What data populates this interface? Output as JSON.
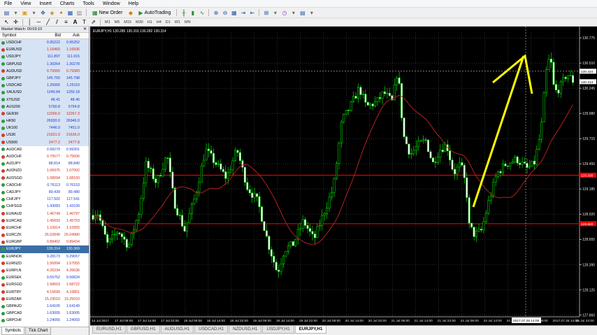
{
  "menu": [
    "File",
    "View",
    "Insert",
    "Charts",
    "Tools",
    "Window",
    "Help"
  ],
  "toolbar": {
    "new_order_label": "New Order",
    "autotrading_label": "AutoTrading",
    "timeframes": [
      "M1",
      "M5",
      "M15",
      "M30",
      "H1",
      "H4",
      "D1",
      "W1",
      "MN"
    ]
  },
  "market_watch": {
    "title": "Market Watch: 00:03:10",
    "col_symbol": "Symbol",
    "col_bid": "Bid",
    "col_ask": "Ask",
    "rows": [
      {
        "symbol": "USDCHF",
        "bid": "0.95222",
        "ask": "0.95252",
        "dir": "up",
        "bg": "blue"
      },
      {
        "symbol": "EURUSD",
        "bid": "1.16460",
        "ask": "1.16506",
        "dir": "down",
        "bg": "blue"
      },
      {
        "symbol": "USDJPY",
        "bid": "111.897",
        "ask": "111.915",
        "dir": "up",
        "bg": "blue"
      },
      {
        "symbol": "GBPUSD",
        "bid": "1.30264",
        "ask": "1.30278",
        "dir": "up",
        "bg": "blue"
      },
      {
        "symbol": "AUDUSD",
        "bid": "0.79365",
        "ask": "0.79383",
        "dir": "down",
        "bg": "blue"
      },
      {
        "symbol": "GBPJPY",
        "bid": "145.769",
        "ask": "145.798",
        "dir": "up",
        "bg": "blue"
      },
      {
        "symbol": "USDCAD",
        "bid": "1.25065",
        "ask": "1.25110",
        "dir": "up",
        "bg": "blue"
      },
      {
        "symbol": "XAUUSD",
        "bid": "1249.84",
        "ask": "1250.18",
        "dir": "up",
        "bg": "blue"
      },
      {
        "symbol": "XTIUSD",
        "bid": "48.41",
        "ask": "48.46",
        "dir": "up",
        "bg": "blue"
      },
      {
        "symbol": "AUS200",
        "bid": "5760.8",
        "ask": "5764.8",
        "dir": "up",
        "bg": "blue"
      },
      {
        "symbol": "GER30",
        "bid": "12266.0",
        "ask": "12267.3",
        "dir": "down",
        "bg": "blue"
      },
      {
        "symbol": "HK50",
        "bid": "26930.0",
        "ask": "26946.0",
        "dir": "up",
        "bg": "blue"
      },
      {
        "symbol": "UK100",
        "bid": "7446.0",
        "ask": "7451.0",
        "dir": "up",
        "bg": "blue"
      },
      {
        "symbol": "US30",
        "bid": "21631.0",
        "ask": "21636.0",
        "dir": "down",
        "bg": "blue"
      },
      {
        "symbol": "US500",
        "bid": "2477.2",
        "ask": "2477.8",
        "dir": "down",
        "bg": "blue"
      },
      {
        "symbol": "AUDCAD",
        "bid": "0.99279",
        "ask": "0.99301",
        "dir": "up",
        "bg": "white"
      },
      {
        "symbol": "AUDCHF",
        "bid": "0.75577",
        "ask": "0.75606",
        "dir": "down",
        "bg": "white"
      },
      {
        "symbol": "AUDJPY",
        "bid": "88.814",
        "ask": "88.840",
        "dir": "up",
        "bg": "white"
      },
      {
        "symbol": "AUDNZD",
        "bid": "1.06975",
        "ask": "1.07002",
        "dir": "down",
        "bg": "white"
      },
      {
        "symbol": "AUDSGD",
        "bid": "1.08094",
        "ask": "1.08150",
        "dir": "down",
        "bg": "white"
      },
      {
        "symbol": "CADCHF",
        "bid": "0.76113",
        "ask": "0.76153",
        "dir": "up",
        "bg": "white"
      },
      {
        "symbol": "CADJPY",
        "bid": "89.439",
        "ask": "89.480",
        "dir": "up",
        "bg": "white"
      },
      {
        "symbol": "CHFJPY",
        "bid": "117.502",
        "ask": "117.541",
        "dir": "up",
        "bg": "white"
      },
      {
        "symbol": "CHFSGD",
        "bid": "1.43083",
        "ask": "1.43109",
        "dir": "up",
        "bg": "white"
      },
      {
        "symbol": "EURAUD",
        "bid": "1.46749",
        "ask": "1.46797",
        "dir": "down",
        "bg": "white"
      },
      {
        "symbol": "EURCAD",
        "bid": "1.45693",
        "ask": "1.45753",
        "dir": "down",
        "bg": "white"
      },
      {
        "symbol": "EURCHF",
        "bid": "1.10914",
        "ask": "1.10955",
        "dir": "down",
        "bg": "white"
      },
      {
        "symbol": "EURCZK",
        "bid": "26.02840",
        "ask": "26.04980",
        "dir": "down",
        "bg": "white"
      },
      {
        "symbol": "EURGBP",
        "bid": "0.89402",
        "ask": "0.89434",
        "dir": "down",
        "bg": "white"
      },
      {
        "symbol": "EURJPY",
        "bid": "130.314",
        "ask": "130.369",
        "dir": "up",
        "bg": "selected"
      },
      {
        "symbol": "EURNOK",
        "bid": "9.28173",
        "ask": "9.29657",
        "dir": "up",
        "bg": "white"
      },
      {
        "symbol": "EURNZD",
        "bid": "1.56994",
        "ask": "1.57055",
        "dir": "down",
        "bg": "white"
      },
      {
        "symbol": "EURPLN",
        "bid": "4.26234",
        "ask": "4.26636",
        "dir": "down",
        "bg": "white"
      },
      {
        "symbol": "EURSEK",
        "bid": "9.55752",
        "ask": "9.56824",
        "dir": "up",
        "bg": "white"
      },
      {
        "symbol": "EURSGD",
        "bid": "1.58653",
        "ask": "1.58722",
        "dir": "down",
        "bg": "white"
      },
      {
        "symbol": "EURTRY",
        "bid": "4.15699",
        "ask": "4.16801",
        "dir": "down",
        "bg": "white"
      },
      {
        "symbol": "EURZAR",
        "bid": "15.23010",
        "ask": "15.25010",
        "dir": "down",
        "bg": "white"
      },
      {
        "symbol": "GBPAUD",
        "bid": "1.64105",
        "ask": "1.64149",
        "dir": "up",
        "bg": "white"
      },
      {
        "symbol": "GBPCAD",
        "bid": "1.63005",
        "ask": "1.63005",
        "dir": "up",
        "bg": "white"
      },
      {
        "symbol": "GBPCHF",
        "bid": "1.24056",
        "ask": "1.24093",
        "dir": "up",
        "bg": "white"
      }
    ],
    "tabs": [
      "Symbols",
      "Tick Chart"
    ]
  },
  "chart": {
    "header": "EURJPY,H1  130.285 130.316 130.282 130.314",
    "y_labels": [
      "130.775",
      "130.510",
      "130.245",
      "129.980",
      "129.715",
      "129.450",
      "129.185",
      "128.920",
      "128.655",
      "128.390",
      "128.125",
      "127.860"
    ],
    "current_price_label": "130.314",
    "crosshair_price_label": "130.424",
    "red_line_upper_label": "129.330",
    "red_line_lower_label": "128.820",
    "x_labels": [
      "14 Jul 2017",
      "17 Jul 06:00",
      "17 Jul 14:00",
      "17 Jul 22:00",
      "18 Jul 06:00",
      "18 Jul 14:00",
      "18 Jul 22:00",
      "19 Jul 06:00",
      "19 Jul 14:00",
      "19 Jul 22:00",
      "20 Jul 06:00",
      "20 Jul 14:00",
      "20 Jul 22:00",
      "21 Jul 06:00",
      "21 Jul 14:00",
      "21 Jul 22:00",
      "24 Jul 06:00",
      "24 Jul 14:00",
      "24 Jul 22:00",
      "25 Jul 06:00",
      "2017.07.25 14:00",
      "25 Jul 22:00"
    ],
    "colors": {
      "background": "#000000",
      "grid": "#4a4a4a",
      "bull": "#00ff00",
      "bear": "#ffffff",
      "ma": "#b02020",
      "level": "#ff0000",
      "arrow": "#ffff00"
    }
  },
  "chart_tabs": [
    "EURUSD,H1",
    "GBPUSD,H1",
    "AUDUSD,H1",
    "USDCAD,H1",
    "NZDUSD,H1",
    "USDJPY,H1",
    "EURJPY,H1"
  ],
  "active_chart_tab": "EURJPY,H1",
  "icons": [
    "new-chart-icon",
    "profiles-icon",
    "market-watch-icon",
    "navigator-icon",
    "terminal-icon",
    "tester-icon",
    "new-order-icon",
    "autotrading-icon",
    "bar-chart-icon",
    "candlestick-icon",
    "line-chart-icon",
    "zoom-in-icon",
    "zoom-out-icon",
    "tile-icon",
    "autoscroll-icon",
    "chart-shift-icon",
    "indicators-icon",
    "templates-icon"
  ]
}
